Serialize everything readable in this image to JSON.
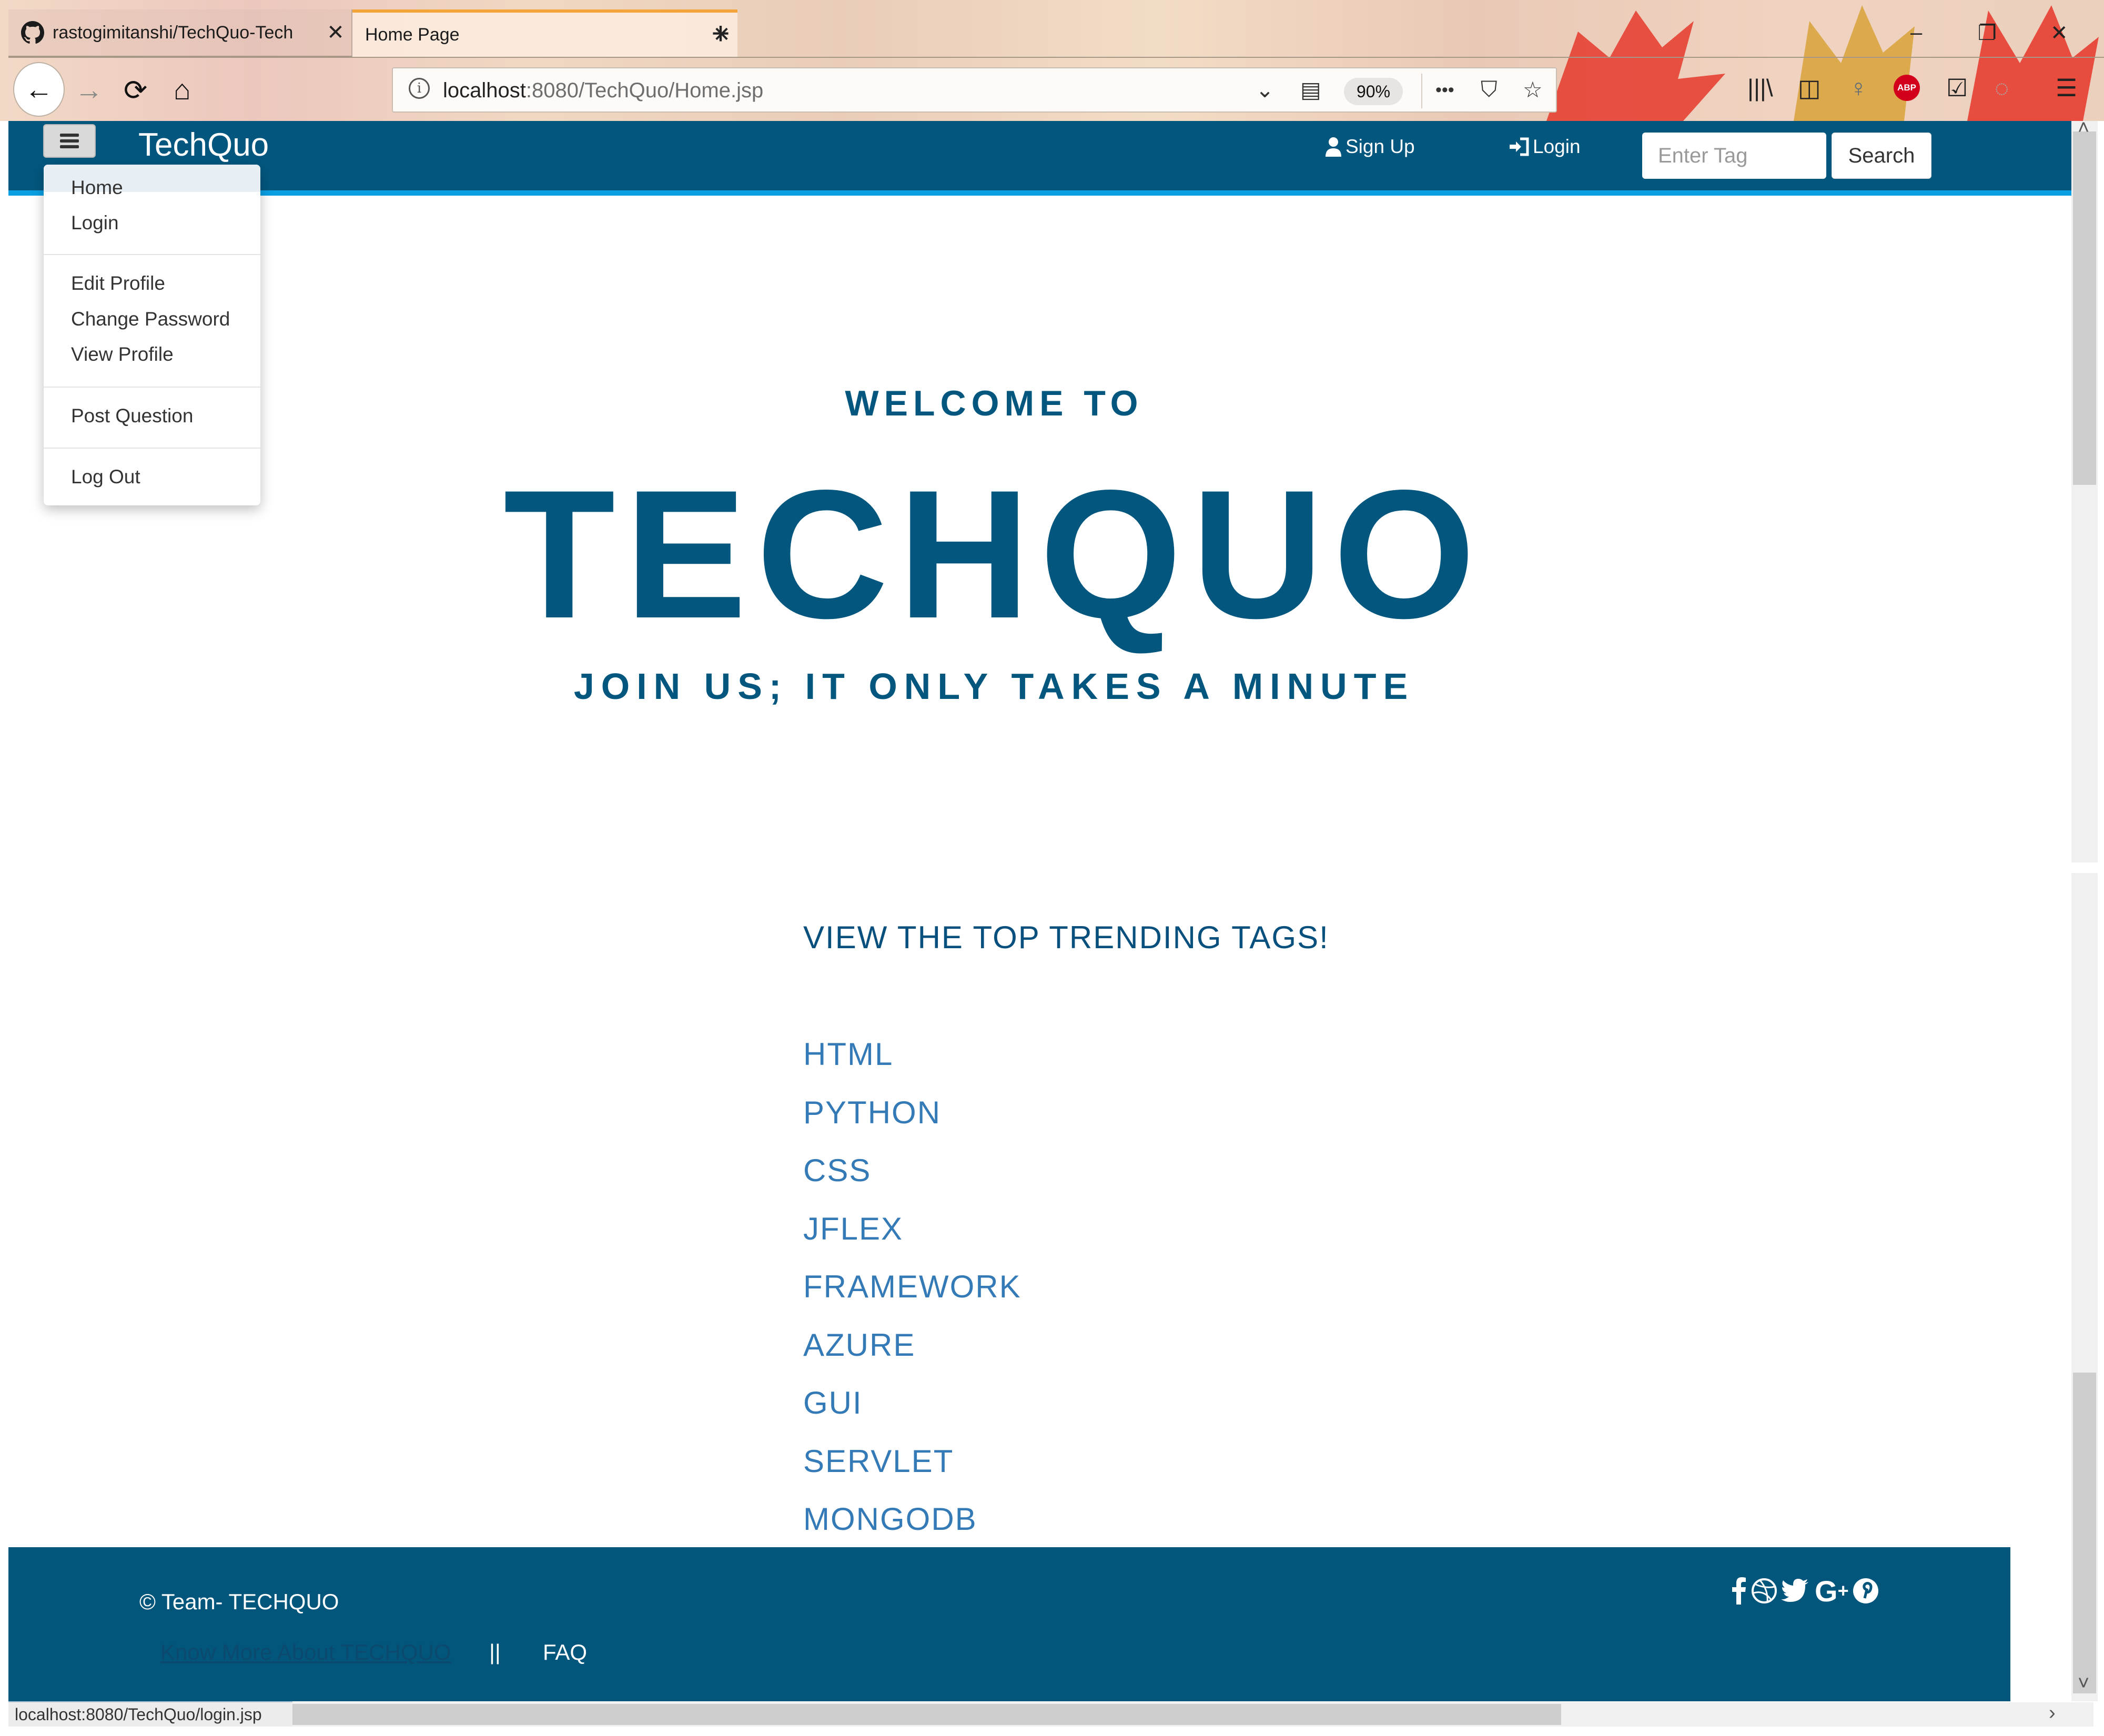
{
  "browser": {
    "tabs": [
      {
        "title": "rastogimitanshi/TechQuo-Tech",
        "icon": "github-icon",
        "active": false
      },
      {
        "title": "Home Page",
        "active": true
      }
    ],
    "new_tab_label": "+",
    "url_host": "localhost",
    "url_rest": ":8080/TechQuo/Home.jsp",
    "zoom_level": "90%",
    "status_url": "localhost:8080/TechQuo/login.jsp",
    "icons": {
      "back": "←",
      "forward": "→",
      "reload": "⟳",
      "home": "⌂",
      "dropdown": "⌄",
      "reader": "▤",
      "more": "•••",
      "pocket": "⛉",
      "star": "☆",
      "library": "|||\\",
      "sidebar": "◫",
      "lightbulb": "♀",
      "abp": "ABP",
      "screenshot": "☑",
      "sync": "◌",
      "menu": "☰",
      "minimize": "–",
      "restore": "❐",
      "close": "✕",
      "tab_close": "✕"
    }
  },
  "navbar": {
    "brand": "TechQuo",
    "signup_label": "Sign Up",
    "signup_icon": "👤",
    "login_label": "Login",
    "login_icon": "⇥",
    "search_placeholder": "Enter Tag",
    "search_value": "",
    "search_button": "Search",
    "colors": {
      "bar": "#03577f",
      "underline": "#0a9fe3"
    }
  },
  "dropdown_menu": {
    "open": true,
    "groups": [
      [
        {
          "label": "Home"
        },
        {
          "label": "Login"
        }
      ],
      [
        {
          "label": "Edit Profile"
        },
        {
          "label": "Change Password"
        },
        {
          "label": "View Profile"
        }
      ],
      [
        {
          "label": "Post Question"
        }
      ],
      [
        {
          "label": "Log Out"
        }
      ]
    ]
  },
  "hero": {
    "welcome": "WELCOME TO",
    "title": "TECHQUO",
    "tagline": "JOIN US; IT ONLY TAKES A MINUTE"
  },
  "trending": {
    "header": "VIEW THE TOP TRENDING TAGS!",
    "tags": [
      "HTML",
      "PYTHON",
      "CSS",
      "JFLEX",
      "FRAMEWORK",
      "AZURE",
      "GUI",
      "SERVLET",
      "MONGODB"
    ]
  },
  "footer": {
    "copyright": "© Team- TECHQUO",
    "know_more": "Know More About TECHQUO",
    "separator": "||",
    "faq": "FAQ",
    "social_icons": [
      "facebook-icon",
      "dribbble-icon",
      "twitter-icon",
      "google-plus-icon",
      "pinterest-icon"
    ],
    "social_glyphs": {
      "facebook": "f",
      "dribbble": "⊛",
      "twitter": "🐦",
      "googleplus": "G+",
      "pinterest": "℗"
    }
  },
  "scrollbars": {
    "up": "˄",
    "down": "˅",
    "right": "›"
  }
}
